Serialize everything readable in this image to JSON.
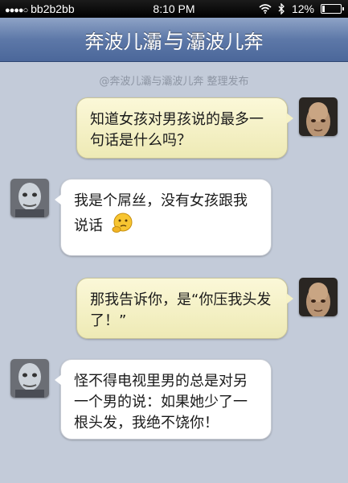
{
  "status_bar": {
    "signal_dots": "●●●●○",
    "carrier": "bb2b2bb",
    "time": "8:10 PM",
    "battery": "12%",
    "battery_level": 0.12
  },
  "header": {
    "title_left": "奔波儿灞",
    "title_mid": "与",
    "title_right": "灞波儿奔"
  },
  "credit": "@奔波儿灞与灞波儿奔 整理发布",
  "messages": [
    {
      "side": "right",
      "text": "知道女孩对男孩说的最多一句话是什么吗？"
    },
    {
      "side": "left",
      "text": "我是个屌丝，没有女孩跟我说话",
      "emoji": "thinking-face-icon"
    },
    {
      "side": "right",
      "text": "那我告诉你，是“你压我头发了！”"
    },
    {
      "side": "left",
      "text": "怪不得电视里男的总是对另一个男的说：如果她少了一根头发，我绝不饶你！"
    }
  ],
  "colors": {
    "background": "#c3cbd9",
    "header": "#5d78a8",
    "bubble_right": "#f6f2c6",
    "bubble_left": "#ffffff"
  }
}
